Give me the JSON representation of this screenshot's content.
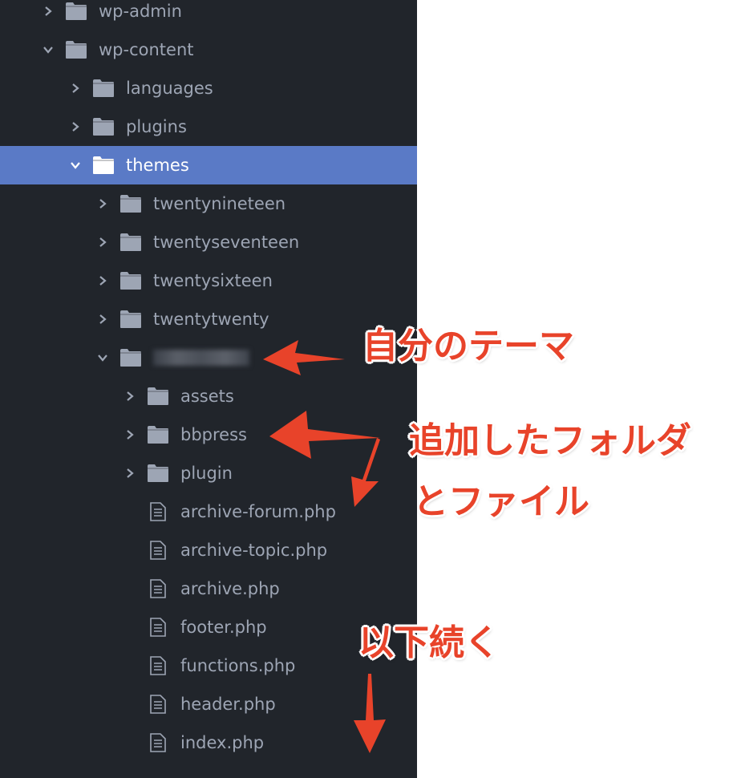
{
  "colors": {
    "background": "#21252b",
    "text": "#9da5b4",
    "selected": "#5a7ac6",
    "folder": "#9da5b4",
    "annotation": "#e8432a"
  },
  "tree": [
    {
      "label": "wp-admin",
      "depth": 0,
      "type": "folder",
      "expanded": false
    },
    {
      "label": "wp-content",
      "depth": 0,
      "type": "folder",
      "expanded": true
    },
    {
      "label": "languages",
      "depth": 1,
      "type": "folder",
      "expanded": false
    },
    {
      "label": "plugins",
      "depth": 1,
      "type": "folder",
      "expanded": false
    },
    {
      "label": "themes",
      "depth": 1,
      "type": "folder",
      "expanded": true,
      "selected": true
    },
    {
      "label": "twentynineteen",
      "depth": 2,
      "type": "folder",
      "expanded": false
    },
    {
      "label": "twentyseventeen",
      "depth": 2,
      "type": "folder",
      "expanded": false
    },
    {
      "label": "twentysixteen",
      "depth": 2,
      "type": "folder",
      "expanded": false
    },
    {
      "label": "twentytwenty",
      "depth": 2,
      "type": "folder",
      "expanded": false
    },
    {
      "label": "",
      "depth": 2,
      "type": "folder",
      "expanded": true,
      "blurred": true
    },
    {
      "label": "assets",
      "depth": 3,
      "type": "folder",
      "expanded": false
    },
    {
      "label": "bbpress",
      "depth": 3,
      "type": "folder",
      "expanded": false
    },
    {
      "label": "plugin",
      "depth": 3,
      "type": "folder",
      "expanded": false
    },
    {
      "label": "archive-forum.php",
      "depth": 3,
      "type": "file"
    },
    {
      "label": "archive-topic.php",
      "depth": 3,
      "type": "file"
    },
    {
      "label": "archive.php",
      "depth": 3,
      "type": "file"
    },
    {
      "label": "footer.php",
      "depth": 3,
      "type": "file"
    },
    {
      "label": "functions.php",
      "depth": 3,
      "type": "file"
    },
    {
      "label": "header.php",
      "depth": 3,
      "type": "file"
    },
    {
      "label": "index.php",
      "depth": 3,
      "type": "file"
    }
  ],
  "annotations": {
    "my_theme": "自分のテーマ",
    "added_line1": "追加したフォルダ",
    "added_line2": "とファイル",
    "continues": "以下続く"
  }
}
